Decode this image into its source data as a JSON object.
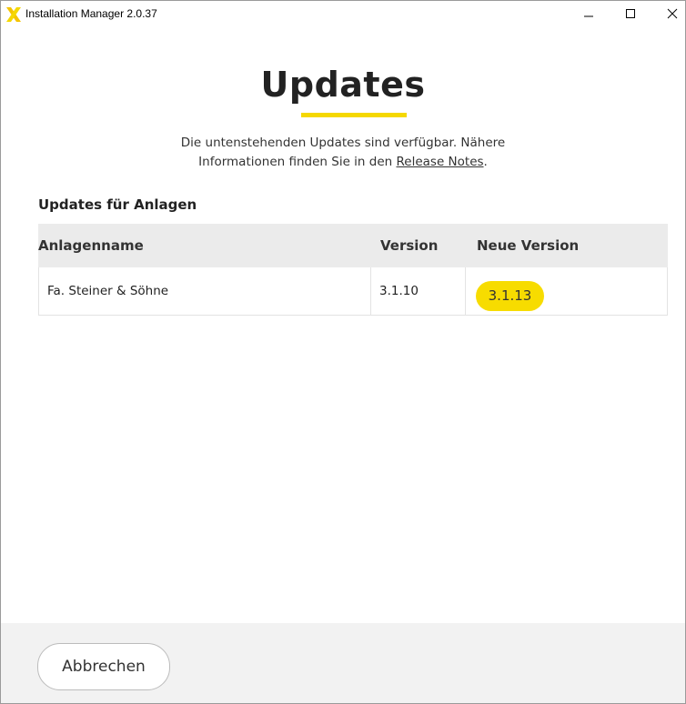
{
  "window": {
    "title": "Installation Manager 2.0.37",
    "logo_icon": "x-logo-icon",
    "controls": {
      "minimize_icon": "minimize-icon",
      "maximize_icon": "maximize-icon",
      "close_icon": "close-icon"
    }
  },
  "header": {
    "title": "Updates",
    "intro_line1": "Die untenstehenden Updates sind verfügbar. Nähere",
    "intro_line2_prefix": "Informationen finden Sie in den ",
    "release_notes_link": "Release Notes",
    "intro_line2_suffix": "."
  },
  "section": {
    "title": "Updates für Anlagen"
  },
  "table": {
    "columns": [
      "Anlagenname",
      "Version",
      "Neue Version"
    ],
    "rows": [
      {
        "name": "Fa. Steiner & Söhne",
        "version": "3.1.10",
        "new_version": "3.1.13"
      }
    ]
  },
  "footer": {
    "cancel_label": "Abbrechen"
  },
  "colors": {
    "accent_yellow": "#f7dc00",
    "header_bg": "#ebebeb",
    "footer_bg": "#f2f2f2"
  }
}
